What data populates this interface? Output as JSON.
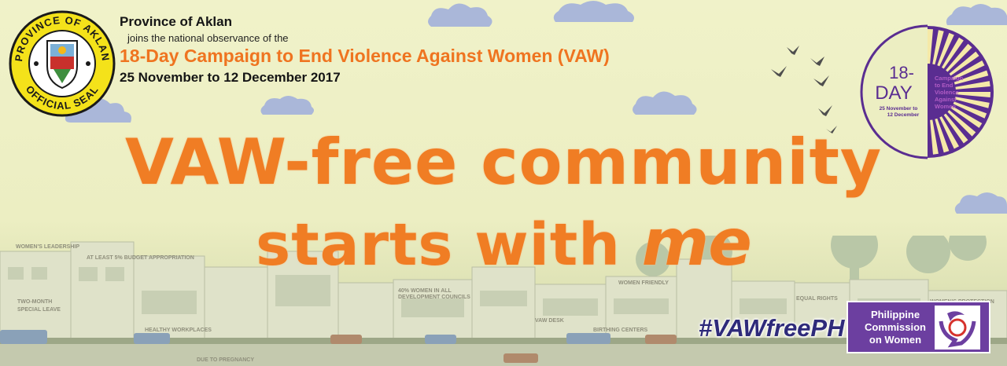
{
  "seal": {
    "top_text": "PROVINCE OF AKLAN",
    "bottom_text": "OFFICIAL SEAL"
  },
  "header": {
    "province": "Province of Aklan",
    "joins": "joins the national observance of the",
    "campaign": "18-Day Campaign to End Violence Against Women (VAW)",
    "dates": "25 November to 12 December 2017"
  },
  "main": {
    "line1": "VAW-free community",
    "line2_prefix": "starts with ",
    "line2_emphasis": "me"
  },
  "logo18": {
    "number": "18-",
    "day": "DAY",
    "title_lines": [
      "Campaign",
      "to End",
      "Violence",
      "Against",
      "Women"
    ],
    "date_lines": [
      "25 November to",
      "12 December"
    ]
  },
  "hashtag": "#VAWfreePH",
  "pcw": {
    "name_lines": [
      "Philippine",
      "Commission",
      "on Women"
    ]
  },
  "town_signs": [
    "WOMEN'S LEADERSHIP",
    "AT LEAST 5% BUDGET APPROPRIATION",
    "TWO-MONTH SPECIAL LEAVE",
    "HEALTHY WORKPLACES WITH BREASTFEEDING STATIONS",
    "DUE TO PREGNANCY",
    "40% WOMEN IN ALL DEVELOPMENT COUNCILS",
    "VAW DESK",
    "BIRTHING CENTERS",
    "WOMEN FRIENDLY",
    "EQUAL RIGHTS",
    "WOMEN'S PROTECTION AND SECURITY"
  ],
  "colors": {
    "background": "#ecefc4",
    "orange": "#f07d24",
    "purple": "#5a2d91",
    "seal_yellow": "#f4e21a",
    "navy": "#2e2a7a"
  }
}
